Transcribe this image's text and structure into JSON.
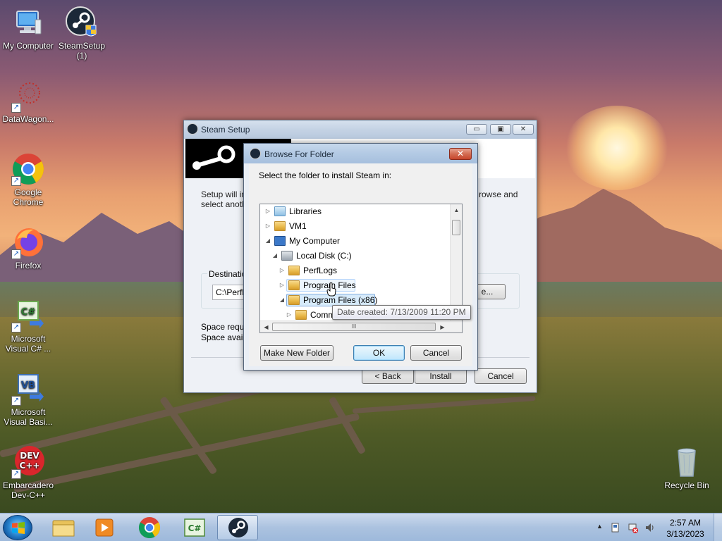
{
  "desktop": {
    "icons": [
      {
        "label": "My Computer",
        "icon": "computer-icon"
      },
      {
        "label": "SteamSetup\n(1)",
        "icon": "steam-setup-icon"
      },
      {
        "label": "DataWagon...",
        "icon": "datawagon-icon"
      },
      {
        "label": "Google\nChrome",
        "icon": "chrome-icon"
      },
      {
        "label": "Firefox",
        "icon": "firefox-icon"
      },
      {
        "label": "Microsoft\nVisual C# ...",
        "icon": "visual-csharp-icon",
        "badge": "C#"
      },
      {
        "label": "Microsoft\nVisual Basi...",
        "icon": "visual-basic-icon",
        "badge": "VB"
      },
      {
        "label": "Embarcadero\nDev-C++",
        "icon": "devcpp-icon",
        "badge": "DEV\nC++"
      },
      {
        "label": "Recycle Bin",
        "icon": "recycle-bin-icon"
      }
    ]
  },
  "steam_setup": {
    "title": "Steam Setup",
    "body_text_1": "Setup will ins",
    "body_text_2": "select anoth",
    "body_text_right_1": "rowse and",
    "destination_label": "Destination",
    "destination_value": "C:\\Perfl",
    "browse_button": "e...",
    "space_required": "Space requir",
    "space_available": "Space availa",
    "back_button": "< Back",
    "install_button": "Install",
    "cancel_button": "Cancel"
  },
  "browse_dialog": {
    "title": "Browse For Folder",
    "instruction": "Select the folder to install Steam in:",
    "tree": [
      {
        "label": "Libraries",
        "level": 0,
        "expander": "▷",
        "icon": "libraries-icon"
      },
      {
        "label": "VM1",
        "level": 0,
        "expander": "▷",
        "icon": "user-folder-icon"
      },
      {
        "label": "My Computer",
        "level": 0,
        "expander": "◢",
        "icon": "computer-icon"
      },
      {
        "label": "Local Disk (C:)",
        "level": 1,
        "expander": "◢",
        "icon": "drive-icon"
      },
      {
        "label": "PerfLogs",
        "level": 2,
        "expander": "▷",
        "icon": "folder-icon"
      },
      {
        "label": "Program Files",
        "level": 2,
        "expander": "▷",
        "icon": "folder-icon",
        "state": "hover"
      },
      {
        "label": "Program Files (x86)",
        "level": 2,
        "expander": "◢",
        "icon": "folder-icon",
        "state": "selected"
      },
      {
        "label": "Comm",
        "level": 3,
        "expander": "▷",
        "icon": "folder-icon"
      }
    ],
    "tooltip": "Date created: 7/13/2009 11:20 PM",
    "make_new_folder_button": "Make New Folder",
    "ok_button": "OK",
    "cancel_button": "Cancel",
    "close_glyph": "✕",
    "hscroll_grip": "III"
  },
  "taskbar": {
    "items": [
      {
        "name": "windows-explorer",
        "icon": "folder-icon"
      },
      {
        "name": "media-player",
        "icon": "media-player-icon"
      },
      {
        "name": "chrome",
        "icon": "chrome-icon"
      },
      {
        "name": "visual-csharp",
        "icon": "visual-csharp-icon",
        "badge": "C#"
      },
      {
        "name": "steam",
        "icon": "steam-icon",
        "active": true
      }
    ],
    "tray_arrow": "▲",
    "time": "2:57 AM",
    "date": "3/13/2023"
  }
}
